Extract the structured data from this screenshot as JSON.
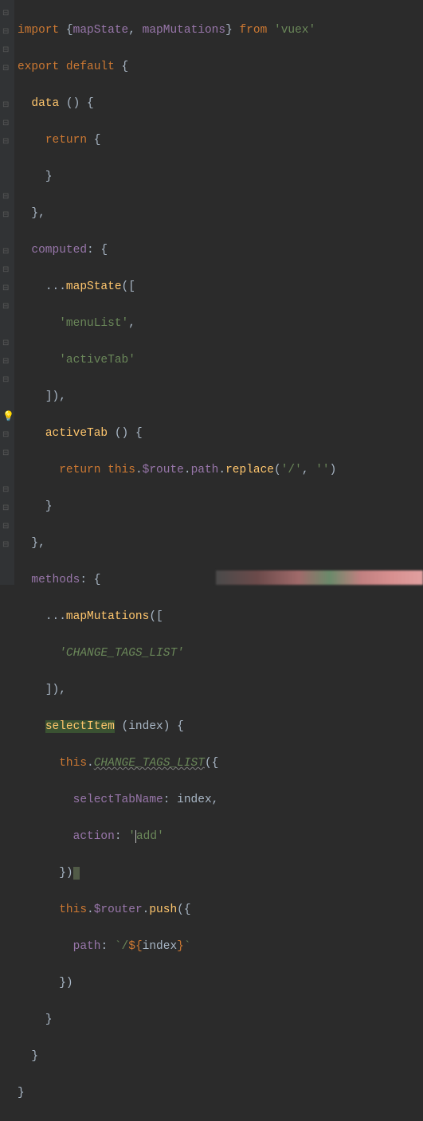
{
  "code": {
    "l1": {
      "kw1": "import",
      "brace1": "{",
      "id1": "mapState",
      "comma": ", ",
      "id2": "mapMutations",
      "brace2": "}",
      "kw2": " from ",
      "str": "'vuex'"
    },
    "l2": {
      "kw1": "export",
      "kw2": " default ",
      "brace": "{"
    },
    "l3": {
      "name": "data",
      "parens": " () {"
    },
    "l4": {
      "kw": "return",
      "brace": " {"
    },
    "l5": {
      "brace": "}"
    },
    "l6": {
      "brace": "},"
    },
    "l7": {
      "name": "computed",
      "rest": ": {"
    },
    "l8": {
      "spread": "...",
      "fn": "mapState",
      "paren": "(["
    },
    "l9": {
      "str": "'menuList'",
      "comma": ","
    },
    "l10": {
      "str": "'activeTab'"
    },
    "l11": {
      "close": "]),"
    },
    "l12": {
      "name": "activeTab",
      "rest": " () {"
    },
    "l13": {
      "kw": "return ",
      "this": "this",
      "dot1": ".",
      "route": "$route",
      "dot2": ".",
      "path": "path",
      "dot3": ".",
      "replace": "replace",
      "paren1": "(",
      "str1": "'/'",
      "comma": ", ",
      "str2": "''",
      "paren2": ")"
    },
    "l14": {
      "brace": "}"
    },
    "l15": {
      "brace": "},"
    },
    "l16": {
      "name": "methods",
      "rest": ": {"
    },
    "l17": {
      "spread": "...",
      "fn": "mapMutations",
      "paren": "(["
    },
    "l18": {
      "str": "'CHANGE_TAGS_LIST'"
    },
    "l19": {
      "close": "]),"
    },
    "l20": {
      "name": "selectItem",
      "rest": " (index) {"
    },
    "l21": {
      "this": "this",
      "dot": ".",
      "fn": "CHANGE_TAGS_LIST",
      "paren": "({"
    },
    "l22": {
      "prop": "selectTabName",
      "rest": ": index,"
    },
    "l23": {
      "prop": "action",
      "colon": ": ",
      "q1": "'",
      "val": "add",
      "q2": "'"
    },
    "l24": {
      "close": "})"
    },
    "l25": {
      "this": "this",
      "dot": ".",
      "router": "$router",
      "dot2": ".",
      "push": "push",
      "paren": "({"
    },
    "l26": {
      "prop": "path",
      "colon": ": ",
      "tick1": "`",
      "slash": "/",
      "dollar": "${",
      "var": "index",
      "close": "}",
      "tick2": "`"
    },
    "l27": {
      "close": "})"
    },
    "l28": {
      "brace": "}"
    },
    "l29": {
      "brace": "}"
    },
    "l30": {
      "brace": "}"
    }
  },
  "gutter": {
    "bulb_line": 23,
    "fold_lines": [
      1,
      2,
      3,
      4,
      6,
      7,
      8,
      11,
      12,
      14,
      15,
      16,
      17,
      19,
      20,
      21,
      24,
      25,
      27,
      28,
      29,
      30
    ]
  }
}
